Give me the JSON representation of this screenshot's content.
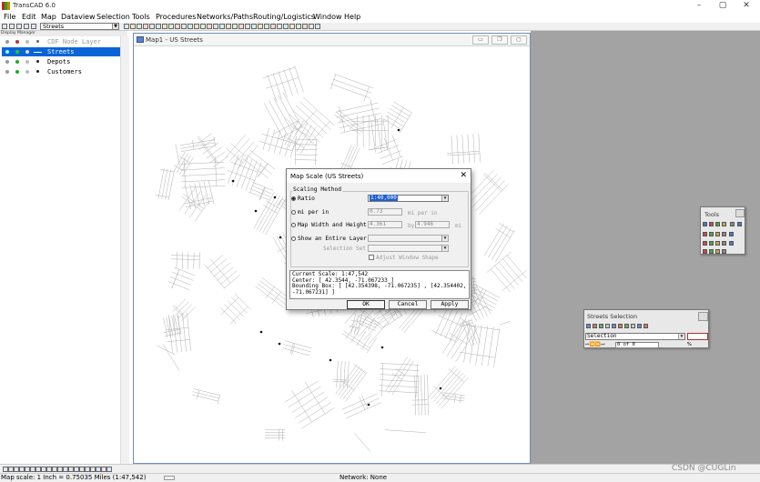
{
  "app": {
    "title": "TransCAD 6.0",
    "win_minimize": "–",
    "win_maximize": "▢",
    "win_close": "✕"
  },
  "menu": [
    "File",
    "Edit",
    "Map",
    "Dataview",
    "Selection",
    "Tools",
    "Procedures",
    "Networks/Paths",
    "Routing/Logistics",
    "Window",
    "Help"
  ],
  "toolbar": {
    "layer_combo": "Streets"
  },
  "display_manager": {
    "caption": "Display Manager",
    "layers": [
      {
        "name": "CDF Node Layer",
        "dim": true,
        "selected": false
      },
      {
        "name": "Streets",
        "dim": false,
        "selected": true
      },
      {
        "name": "Depots",
        "dim": false,
        "selected": false
      },
      {
        "name": "Customers",
        "dim": false,
        "selected": false
      }
    ]
  },
  "map_window": {
    "title": "Map1 - US Streets"
  },
  "dialog": {
    "title": "Map Scale (US Streets)",
    "close": "✕",
    "group_label": "Scaling Method",
    "ratio_label": "Ratio",
    "ratio_value": "1:40,000",
    "mi_per_in_label": "mi per in",
    "mi_per_in_value": "0.73",
    "mi_per_in_unit": "mi per in",
    "width_height_label": "Map Width and Height",
    "width_value": "4.361",
    "width_sep": "by",
    "height_value": "4.946",
    "height_unit": "mi",
    "entire_layer_label": "Show an Entire Layer",
    "selection_set_label": "Selection Set",
    "adjust_label": "Adjust Window Shape",
    "info_lines": [
      "Current Scale: 1:47,542",
      "Center: [ 42.3544, -71.067233 ]",
      "Bounding Box: [ [42.354398, -71.067235] , [42.354402,",
      "-71.067231] ]"
    ],
    "ok": "OK",
    "cancel": "Cancel",
    "apply": "Apply"
  },
  "tools_window": {
    "title": "Tools"
  },
  "selection_window": {
    "title": "Streets Selection",
    "combo": "Selection",
    "count": "0 of 0",
    "pct": "%"
  },
  "status": {
    "map_scale": "Map scale: 1 Inch = 0.75035 Miles (1:47,542)",
    "network": "Network: None"
  },
  "watermark": "CSDN @CUGLin"
}
